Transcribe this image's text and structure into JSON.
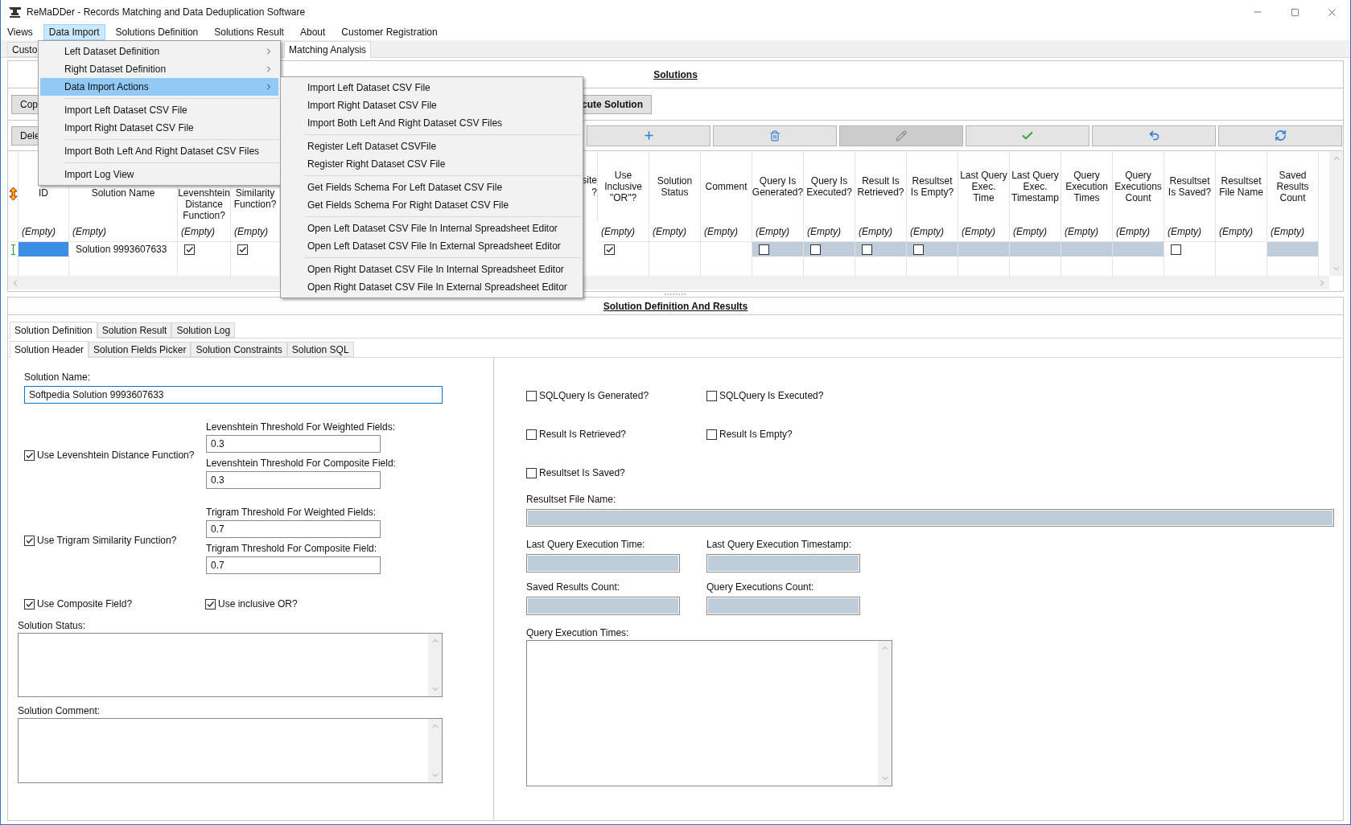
{
  "window": {
    "title": "ReMaDDer - Records Matching and Data Deduplication Software"
  },
  "menu_bar": [
    {
      "label": "Views",
      "selected": false
    },
    {
      "label": "Data Import",
      "selected": true
    },
    {
      "label": "Solutions Definition",
      "selected": false
    },
    {
      "label": "Solutions Result",
      "selected": false
    },
    {
      "label": "About",
      "selected": false
    },
    {
      "label": "Customer Registration",
      "selected": false
    }
  ],
  "main_tabs": [
    {
      "label": "Custo",
      "selected": false
    },
    {
      "label": "Matching Analysis",
      "selected": true
    }
  ],
  "solutions": {
    "title": "Solutions",
    "copy_button": "Cop",
    "execute_button": "cute Solution",
    "delete_button": "Dele",
    "toolbar": [
      {
        "kind": "add",
        "disabled": false
      },
      {
        "kind": "delete",
        "disabled": false
      },
      {
        "kind": "edit",
        "disabled": true
      },
      {
        "kind": "confirm",
        "disabled": false
      },
      {
        "kind": "undo",
        "disabled": false
      },
      {
        "kind": "refresh",
        "disabled": false
      }
    ],
    "grid": {
      "left_columns": [
        {
          "header": "ID",
          "filter": "(Empty)",
          "cell": {
            "kind": "blank",
            "selected": true
          },
          "readonly": false
        },
        {
          "header": "Solution Name",
          "filter": "(Empty)",
          "cell": {
            "kind": "text",
            "text": "Solution 9993607633"
          },
          "readonly": false
        },
        {
          "header": "Levenshtein Distance Function?",
          "filter": "(Empty)",
          "cell": {
            "kind": "checkbox",
            "checked": true
          },
          "readonly": false
        },
        {
          "header": "Similarity Function?",
          "filter": "(Empty)",
          "cell": {
            "kind": "checkbox",
            "checked": true
          },
          "readonly": false
        }
      ],
      "cut_column": {
        "header": "site ?"
      },
      "right_columns": [
        {
          "header": "Use Inclusive \"OR\"?",
          "filter": "(Empty)",
          "cell": {
            "kind": "checkbox",
            "checked": true
          },
          "readonly": false
        },
        {
          "header": "Solution Status",
          "filter": "(Empty)",
          "cell": {
            "kind": "blank",
            "selected": false
          },
          "readonly": false
        },
        {
          "header": "Comment",
          "filter": "(Empty)",
          "cell": {
            "kind": "blank",
            "selected": false
          },
          "readonly": false
        },
        {
          "header": "Query Is Generated?",
          "filter": "(Empty)",
          "cell": {
            "kind": "checkbox",
            "checked": false
          },
          "readonly": true
        },
        {
          "header": "Query Is Executed?",
          "filter": "(Empty)",
          "cell": {
            "kind": "checkbox",
            "checked": false
          },
          "readonly": true
        },
        {
          "header": "Result Is Retrieved?",
          "filter": "(Empty)",
          "cell": {
            "kind": "checkbox",
            "checked": false
          },
          "readonly": true
        },
        {
          "header": "Resultset Is Empty?",
          "filter": "(Empty)",
          "cell": {
            "kind": "checkbox",
            "checked": false
          },
          "readonly": true
        },
        {
          "header": "Last Query Exec. Time",
          "filter": "(Empty)",
          "cell": {
            "kind": "blank",
            "selected": false
          },
          "readonly": true
        },
        {
          "header": "Last Query Exec. Timestamp",
          "filter": "(Empty)",
          "cell": {
            "kind": "blank",
            "selected": false
          },
          "readonly": true
        },
        {
          "header": "Query Execution Times",
          "filter": "(Empty)",
          "cell": {
            "kind": "blank",
            "selected": false
          },
          "readonly": true
        },
        {
          "header": "Query Executions Count",
          "filter": "(Empty)",
          "cell": {
            "kind": "blank",
            "selected": false
          },
          "readonly": true
        },
        {
          "header": "Resultset Is Saved?",
          "filter": "(Empty)",
          "cell": {
            "kind": "checkbox",
            "checked": false
          },
          "readonly": false
        },
        {
          "header": "Resultset File Name",
          "filter": "(Empty)",
          "cell": {
            "kind": "blank",
            "selected": false
          },
          "readonly": false
        },
        {
          "header": "Saved Results Count",
          "filter": "(Empty)",
          "cell": {
            "kind": "blank",
            "selected": false
          },
          "readonly": true
        }
      ]
    }
  },
  "data_import_menu": [
    {
      "kind": "submenu",
      "label": "Left Dataset Definition",
      "selected": false
    },
    {
      "kind": "submenu",
      "label": "Right Dataset Definition",
      "selected": false
    },
    {
      "kind": "submenu",
      "label": "Data Import Actions",
      "selected": true
    },
    {
      "kind": "separator"
    },
    {
      "kind": "item",
      "label": "Import Left Dataset CSV File",
      "selected": false
    },
    {
      "kind": "item",
      "label": "Import Right Dataset CSV File",
      "selected": false
    },
    {
      "kind": "separator"
    },
    {
      "kind": "item",
      "label": "Import Both Left And Right Dataset CSV Files",
      "selected": false
    },
    {
      "kind": "separator"
    },
    {
      "kind": "item",
      "label": "Import Log View",
      "selected": false
    }
  ],
  "actions_submenu": [
    {
      "kind": "item",
      "label": "Import Left Dataset CSV File"
    },
    {
      "kind": "item",
      "label": "Import Right Dataset CSV File"
    },
    {
      "kind": "item",
      "label": "Import Both Left And Right Dataset CSV Files"
    },
    {
      "kind": "separator"
    },
    {
      "kind": "item",
      "label": "Register Left Dataset CSVFile"
    },
    {
      "kind": "item",
      "label": "Register Right Dataset CSV File"
    },
    {
      "kind": "separator"
    },
    {
      "kind": "item",
      "label": "Get Fields Schema For Left Dataset CSV File"
    },
    {
      "kind": "item",
      "label": "Get Fields Schema For Right Dataset CSV File"
    },
    {
      "kind": "separator"
    },
    {
      "kind": "item",
      "label": "Open Left Dataset CSV File In Internal Spreadsheet Editor"
    },
    {
      "kind": "item",
      "label": "Open Left Dataset CSV File In External Spreadsheet Editor"
    },
    {
      "kind": "separator"
    },
    {
      "kind": "item",
      "label": "Open Right Dataset CSV File In Internal Spreadsheet Editor"
    },
    {
      "kind": "item",
      "label": "Open Right Dataset CSV File In External Spreadsheet Editor"
    }
  ],
  "definition": {
    "title": "Solution Definition And Results",
    "tabs": [
      {
        "label": "Solution Definition",
        "selected": true
      },
      {
        "label": "Solution Result",
        "selected": false
      },
      {
        "label": "Solution Log",
        "selected": false
      }
    ],
    "subtabs": [
      {
        "label": "Solution Header",
        "selected": true
      },
      {
        "label": "Solution Fields Picker",
        "selected": false
      },
      {
        "label": "Solution Constraints",
        "selected": false
      },
      {
        "label": "Solution SQL",
        "selected": false
      }
    ],
    "solution_name": {
      "label": "Solution Name:",
      "value": "Softpedia Solution 9993607633"
    },
    "functions": [
      {
        "label": "Use Levenshtein Distance Function?",
        "checked": true,
        "fields": [
          {
            "label": "Levenshtein Threshold For Weighted Fields:",
            "value": "0.3"
          },
          {
            "label": "Levenshtein Threshold For Composite Field:",
            "value": "0.3"
          }
        ]
      },
      {
        "label": "Use Trigram Similarity Function?",
        "checked": true,
        "fields": [
          {
            "label": "Trigram Threshold For Weighted Fields:",
            "value": "0.7"
          },
          {
            "label": "Trigram Threshold For Composite Field:",
            "value": "0.7"
          }
        ]
      }
    ],
    "composite": {
      "label": "Use Composite Field?",
      "checked": true
    },
    "inclusive_or": {
      "label": "Use inclusive OR?",
      "checked": true
    },
    "status": {
      "label": "Solution Status:"
    },
    "comment": {
      "label": "Solution Comment:"
    }
  },
  "results": {
    "checkboxes": [
      {
        "label": "SQLQuery Is Generated?",
        "checked": false
      },
      {
        "label": "SQLQuery Is Executed?",
        "checked": false
      },
      {
        "label": "Result Is Retrieved?",
        "checked": false
      },
      {
        "label": "Result Is Empty?",
        "checked": false
      },
      {
        "label": "Resultset Is Saved?",
        "checked": false
      }
    ],
    "file_name": {
      "label": "Resultset File Name:"
    },
    "small_fields": [
      {
        "label": "Last Query Execution Time:"
      },
      {
        "label": "Last Query Execution Timestamp:"
      },
      {
        "label": "Saved Results Count:"
      },
      {
        "label": "Query Executions Count:"
      }
    ],
    "execution_times": {
      "label": "Query Execution Times:"
    }
  }
}
